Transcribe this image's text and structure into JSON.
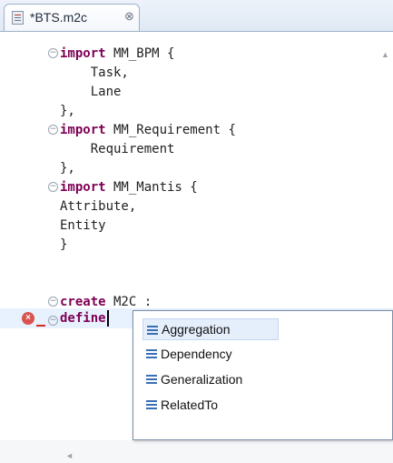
{
  "tab": {
    "title": "*BTS.m2c",
    "close_glyph": "⊗",
    "icon": "m2c-file-icon"
  },
  "editor": {
    "lines": [
      {
        "kw": "import",
        "rest": " MM_BPM {"
      },
      {
        "kw": "",
        "rest": "    Task,"
      },
      {
        "kw": "",
        "rest": "    Lane"
      },
      {
        "kw": "",
        "rest": "},"
      },
      {
        "kw": "import",
        "rest": " MM_Requirement {"
      },
      {
        "kw": "",
        "rest": "    Requirement"
      },
      {
        "kw": "",
        "rest": "},"
      },
      {
        "kw": "import",
        "rest": " MM_Mantis {"
      },
      {
        "kw": "",
        "rest": "Attribute,"
      },
      {
        "kw": "",
        "rest": "Entity"
      },
      {
        "kw": "",
        "rest": "}"
      },
      {
        "kw": "create",
        "rest": " M2C :"
      },
      {
        "kw": "define",
        "rest": ""
      }
    ],
    "error_marker": "error-icon",
    "error_glyph": "×"
  },
  "autocomplete": {
    "items": [
      {
        "label": "Aggregation",
        "icon": "class-icon"
      },
      {
        "label": "Dependency",
        "icon": "class-icon"
      },
      {
        "label": "Generalization",
        "icon": "class-icon"
      },
      {
        "label": "RelatedTo",
        "icon": "class-icon"
      }
    ],
    "selected_index": 0
  },
  "colors": {
    "keyword": "#7f0055",
    "current_line": "#e8f2fe",
    "error": "#d9534f"
  }
}
